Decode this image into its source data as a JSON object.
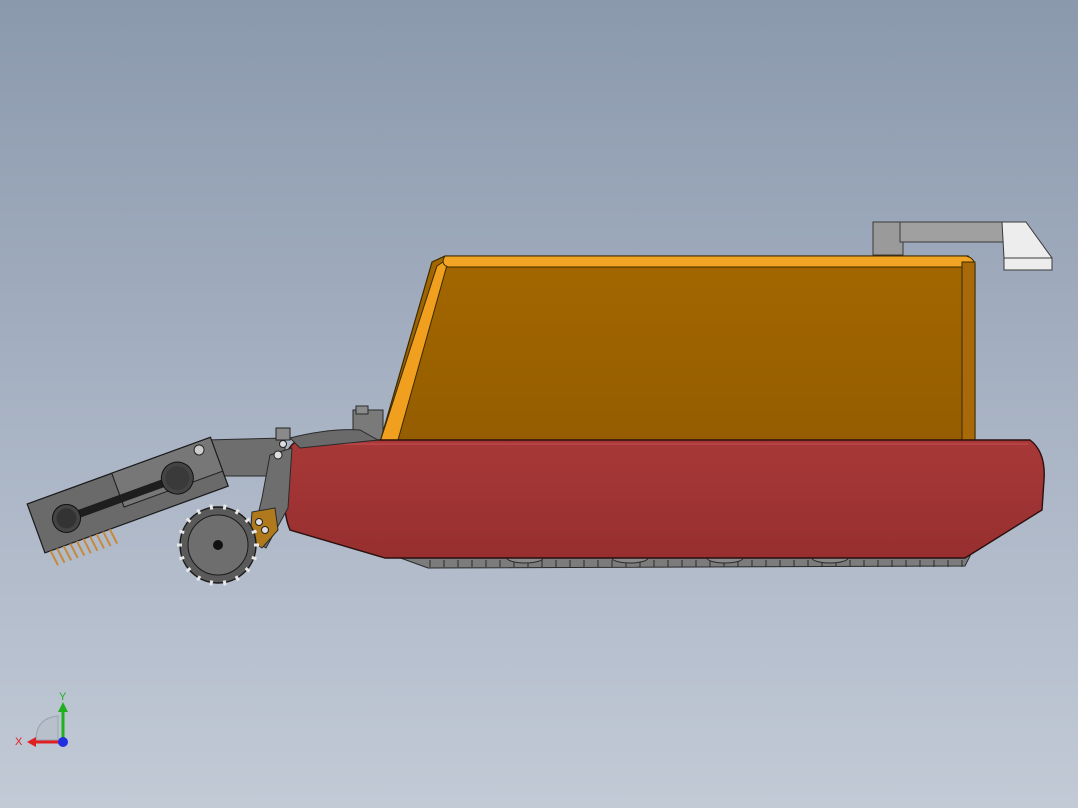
{
  "viewport": {
    "background_top": "#8b99ad",
    "background_bottom": "#c2cad6"
  },
  "model": {
    "body_color": "#9a6000",
    "body_highlight": "#f0a01e",
    "track_color": "#a03434",
    "metal_color": "#6e6e6e",
    "arm_color": "#9a9a9a"
  },
  "triad": {
    "x_label": "X",
    "y_label": "Y",
    "x_color": "#e02020",
    "y_color": "#20b020",
    "z_color": "#2030e0"
  }
}
